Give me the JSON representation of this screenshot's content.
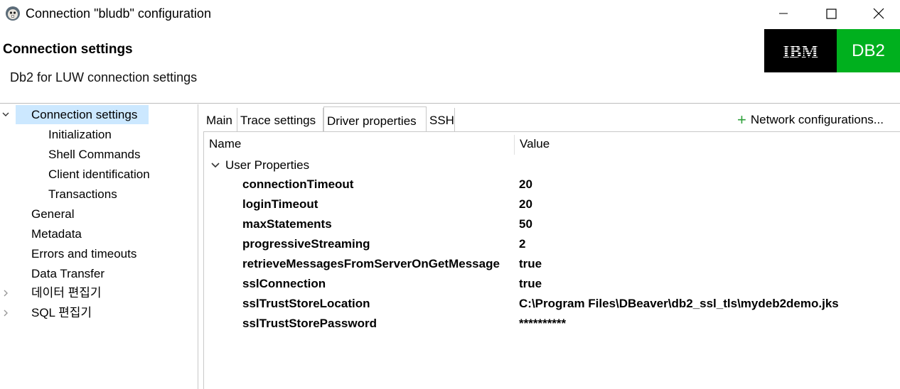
{
  "window": {
    "title": "Connection \"bludb\" configuration",
    "icon": "dbeaver-beaver-icon",
    "controls": [
      "minimize-icon",
      "maximize-icon",
      "close-icon"
    ]
  },
  "header": {
    "title": "Connection settings",
    "subtitle": "Db2 for LUW connection settings",
    "logo": {
      "left_text": "IBM",
      "right_text": "DB2",
      "left_bg": "#000000",
      "right_bg": "#00b01e"
    }
  },
  "nav": {
    "items": [
      {
        "label": "Connection settings",
        "expanded": true,
        "selected": true
      },
      {
        "label": "Initialization"
      },
      {
        "label": "Shell Commands"
      },
      {
        "label": "Client identification"
      },
      {
        "label": "Transactions"
      },
      {
        "label": "General"
      },
      {
        "label": "Metadata"
      },
      {
        "label": "Errors and timeouts"
      },
      {
        "label": "Data Transfer"
      },
      {
        "label": "데이터 편집기",
        "expandable": true
      },
      {
        "label": "SQL 편집기",
        "expandable": true
      }
    ],
    "selected_bg": "#cce8ff"
  },
  "tabs": {
    "items": [
      {
        "label": "Main"
      },
      {
        "label": "Trace settings"
      },
      {
        "label": "Driver properties",
        "active": true
      },
      {
        "label": "SSH"
      }
    ],
    "network_config": "Network configurations..."
  },
  "properties": {
    "columns": {
      "name": "Name",
      "value": "Value"
    },
    "group": "User Properties",
    "rows": [
      {
        "name": "connectionTimeout",
        "value": "20"
      },
      {
        "name": "loginTimeout",
        "value": "20"
      },
      {
        "name": "maxStatements",
        "value": "50"
      },
      {
        "name": "progressiveStreaming",
        "value": "2"
      },
      {
        "name": "retrieveMessagesFromServerOnGetMessage",
        "value": "true"
      },
      {
        "name": "sslConnection",
        "value": "true"
      },
      {
        "name": "sslTrustStoreLocation",
        "value": "C:\\Program Files\\DBeaver\\db2_ssl_tls\\mydeb2demo.jks"
      },
      {
        "name": "sslTrustStorePassword",
        "value": "**********"
      }
    ]
  }
}
